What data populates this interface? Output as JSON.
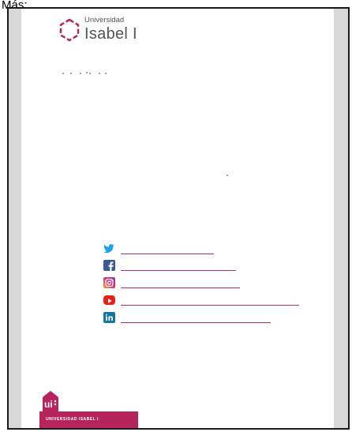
{
  "header_crop": {
    "text": "Más:"
  },
  "logo": {
    "line1": "Universidad",
    "line2": "Isabel I"
  },
  "social_links": [
    {
      "network": "twitter",
      "icon": "twitter-icon",
      "color": "#1da1f2"
    },
    {
      "network": "facebook",
      "icon": "facebook-icon",
      "color": "#3b5998"
    },
    {
      "network": "instagram",
      "icon": "instagram-icon",
      "color": "#c13584"
    },
    {
      "network": "youtube",
      "icon": "youtube-icon",
      "color": "#e62117"
    },
    {
      "network": "linkedin",
      "icon": "linkedin-icon",
      "color": "#0e76a8"
    }
  ],
  "footer": {
    "badge_label": "ui",
    "tagline": "UNIVERSIDAD ISABEL I",
    "brand_color": "#b5245b"
  },
  "colors": {
    "link_underline": "#b0306f",
    "page_bg": "#d8d8d8"
  }
}
